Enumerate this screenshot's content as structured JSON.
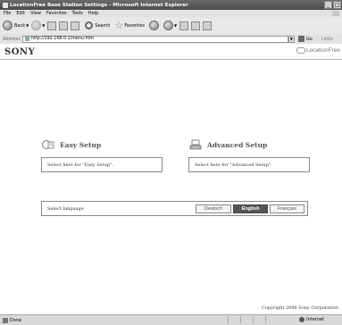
{
  "window": {
    "title": "LocationFree Base Station Settings - Microsoft Internet Explorer"
  },
  "menu": [
    "File",
    "Edit",
    "View",
    "Favorites",
    "Tools",
    "Help"
  ],
  "toolbar": {
    "back_label": "Back",
    "search_label": "Search",
    "favorites_label": "Favorites"
  },
  "address": {
    "label": "Address",
    "url": "http://192.168.0.1/menu.htm",
    "go_label": "Go",
    "links_label": "Links"
  },
  "page": {
    "brand": "SONY",
    "product_logo": "LocationFree",
    "easy_setup": {
      "title": "Easy Setup",
      "description": "Select here for \"Easy Setup\"."
    },
    "advanced_setup": {
      "title": "Advanced Setup",
      "description": "Select here for \"Advanced Setup\"."
    },
    "language": {
      "label": "Select language",
      "options": [
        "Deutsch",
        "English",
        "Français"
      ],
      "selected": "English"
    },
    "copyright": "Copyright 2006 Sony Corporation"
  },
  "status": {
    "text": "Done",
    "zone": "Internet"
  }
}
